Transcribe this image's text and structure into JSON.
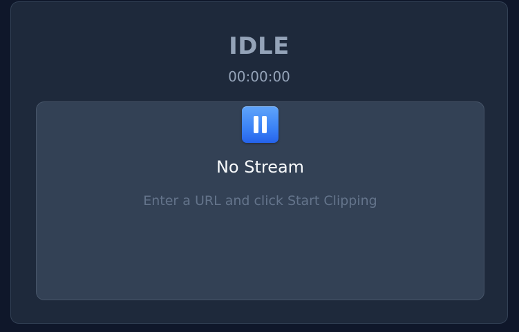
{
  "status": {
    "label": "IDLE",
    "timer": "00:00:00"
  },
  "stream": {
    "icon": "pause-icon",
    "title": "No Stream",
    "hint": "Enter a URL and click Start Clipping"
  },
  "colors": {
    "page_background": "#0f172a",
    "panel_background": "#1e293b",
    "stream_box_background": "#334155",
    "accent": "#3b82f6",
    "muted_text": "#94a3b8",
    "hint_text": "#64748b"
  }
}
